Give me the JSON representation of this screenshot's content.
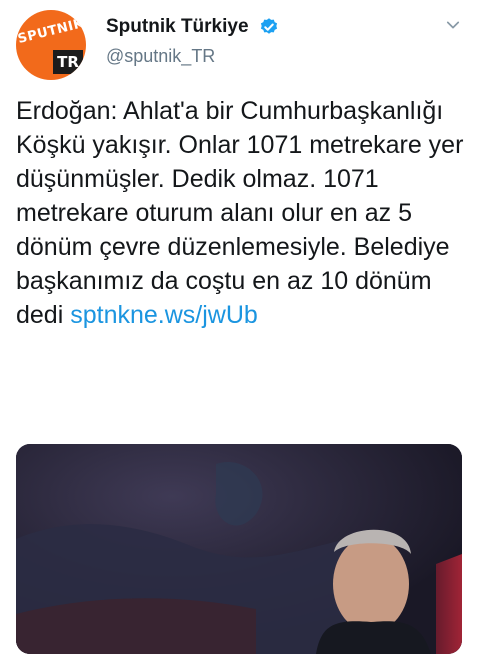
{
  "account": {
    "display_name": "Sputnik Türkiye",
    "handle": "@sputnik_TR",
    "verified": true,
    "avatar_logo_text": "SPUTNIK",
    "avatar_tr_text": "TR"
  },
  "tweet": {
    "text": "Erdoğan: Ahlat'a bir Cumhurbaşkanlığı Köşkü yakışır. Onlar 1071 metrekare yer düşünmüşler. Dedik olmaz. 1071 metrekare oturum alanı olur en az 5 dönüm çevre düzenlemesiyle. Belediye başkanımız da coştu en az 10 dönüm dedi ",
    "link_text": "sptnkne.ws/jwUb"
  },
  "media": {
    "description_hidden": true
  },
  "icons": {
    "caret": "chevron-down-icon",
    "verified": "verified-badge-icon"
  },
  "colors": {
    "brand_orange": "#f26a1b",
    "link_blue": "#1b95e0",
    "verified_blue": "#1da1f2",
    "secondary_text": "#657786"
  }
}
